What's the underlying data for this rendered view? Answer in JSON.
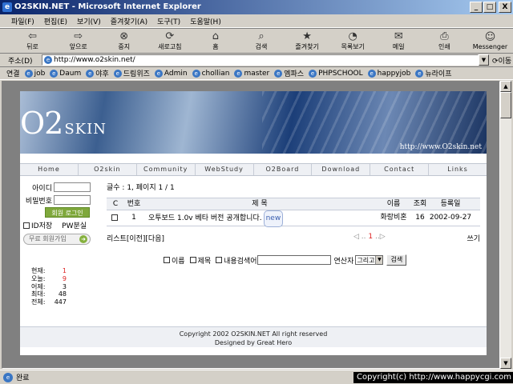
{
  "window": {
    "title": "O2SKIN.NET - Microsoft Internet Explorer",
    "min": "_",
    "max": "□",
    "close": "X"
  },
  "menu": [
    "파일(F)",
    "편집(E)",
    "보기(V)",
    "즐겨찾기(A)",
    "도구(T)",
    "도움말(H)"
  ],
  "toolbar": [
    {
      "label": "뒤로",
      "icon": "back-arrow-icon",
      "glyph": "⇦"
    },
    {
      "label": "앞으로",
      "icon": "forward-arrow-icon",
      "glyph": "⇨"
    },
    {
      "label": "중지",
      "icon": "stop-icon",
      "glyph": "⊗"
    },
    {
      "label": "새로고침",
      "icon": "refresh-icon",
      "glyph": "⟳"
    },
    {
      "label": "홈",
      "icon": "home-icon",
      "glyph": "⌂"
    },
    {
      "label": "검색",
      "icon": "search-icon",
      "glyph": "⌕"
    },
    {
      "label": "즐겨찾기",
      "icon": "favorites-icon",
      "glyph": "★"
    },
    {
      "label": "목록보기",
      "icon": "history-icon",
      "glyph": "◔"
    },
    {
      "label": "메일",
      "icon": "mail-icon",
      "glyph": "✉"
    },
    {
      "label": "인쇄",
      "icon": "print-icon",
      "glyph": "⎙"
    },
    {
      "label": "Messenger",
      "icon": "messenger-icon",
      "glyph": "☺"
    }
  ],
  "address": {
    "label": "주소(D)",
    "value": "http://www.o2skin.net/",
    "go": "⟳이동"
  },
  "links": {
    "label": "연결",
    "items": [
      "job",
      "Daum",
      "야후",
      "드림위즈",
      "Admin",
      "chollian",
      "master",
      "엠파스",
      "PHPSCHOOL",
      "happyjob",
      "뉴라이프"
    ]
  },
  "site": {
    "logo_o": "O2",
    "logo_skin": "SKIN",
    "banner_url": "http://www.O2skin.net",
    "nav": [
      "Home",
      "O2skin",
      "Community",
      "WebStudy",
      "O2Board",
      "Download",
      "Contact",
      "Links"
    ]
  },
  "login": {
    "id_label": "아이디",
    "pw_label": "비밀번호",
    "login_button": "회원 로그인",
    "save_id": "ID저장",
    "pw_lost": "PW분실",
    "join_button": "무료 회원가입"
  },
  "stats": [
    {
      "label": "현재:",
      "value": "1",
      "red": true
    },
    {
      "label": "오늘:",
      "value": "9",
      "red": true
    },
    {
      "label": "어제:",
      "value": "3",
      "red": false
    },
    {
      "label": "최대:",
      "value": "48",
      "red": false
    },
    {
      "label": "전체:",
      "value": "447",
      "red": false
    }
  ],
  "board": {
    "count_text": "글수 : 1, 페이지 1 / 1",
    "headers": {
      "c": "C",
      "num": "번호",
      "title": "제 목",
      "name": "이름",
      "hits": "조회",
      "date": "등록일"
    },
    "rows": [
      {
        "num": "1",
        "title": "오투보드 1.0v 베타 버전 공개합니다.",
        "badge": "new",
        "name": "화랑비혼",
        "hits": "16",
        "date": "2002-09-27"
      }
    ],
    "list_links": "리스트[이전][다음]",
    "pager_prev": "◁ .. ",
    "pager_cur": "1",
    "pager_next": " ..▷",
    "write": "쓰기"
  },
  "search": {
    "opt_name": "이름",
    "opt_subject": "제목",
    "opt_content": "내용검색어",
    "operator_label": "연산자",
    "operator_value": "그리고",
    "button": "검색"
  },
  "footer": {
    "line1": "Copyright 2002 O2SKIN.NET All right reserved",
    "line2": "Designed by Great Hero"
  },
  "status": {
    "text": "완료"
  },
  "overlay_copyright": "Copyright(c) http://www.happycgi.com"
}
